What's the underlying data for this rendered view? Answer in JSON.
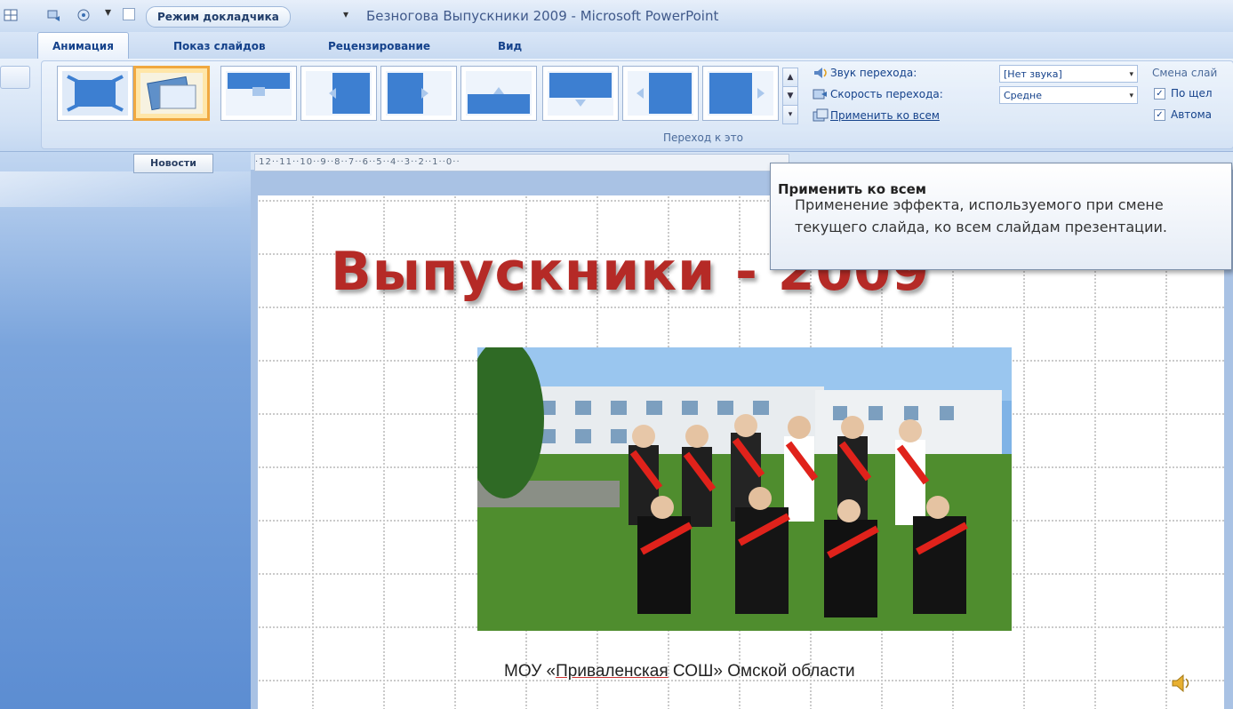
{
  "window": {
    "title": "Безногова Выпускники 2009 - Microsoft PowerPoint",
    "qat_mode_label": "Режим докладчика",
    "qat_arrow": "▾"
  },
  "tabs": [
    {
      "label": "Анимация",
      "active": true
    },
    {
      "label": "Показ слайдов",
      "active": false
    },
    {
      "label": "Рецензирование",
      "active": false
    },
    {
      "label": "Вид",
      "active": false
    }
  ],
  "ribbon": {
    "transition_gallery": {
      "selected_index": 1,
      "group_label": "Переход к это"
    },
    "sound_label": "Звук перехода:",
    "sound_value": "[Нет звука]",
    "speed_label": "Скорость перехода:",
    "speed_value": "Средне",
    "apply_all_label": "Применить ко всем",
    "advance_group_label": "Смена слай",
    "on_click_label": "По щел",
    "auto_label": "Автома",
    "on_click_checked": true,
    "auto_checked": true
  },
  "editor": {
    "news_button": "Новости",
    "ruler_text": "·12··11··10··9··8··7··6··5··4··3··2··1··0··"
  },
  "slide": {
    "title": "Выпускники - 2009",
    "caption_prefix": "МОУ «",
    "caption_underlined": "Приваленская",
    "caption_suffix": " СОШ» Омской области"
  },
  "tooltip": {
    "title": "Применить ко всем",
    "body": "Применение эффекта, используемого при смене текущего слайда, ко всем слайдам презентации."
  },
  "colors": {
    "accent_select": "#f0a840",
    "title_red": "#b52a26",
    "ribbon_text": "#15428b"
  }
}
